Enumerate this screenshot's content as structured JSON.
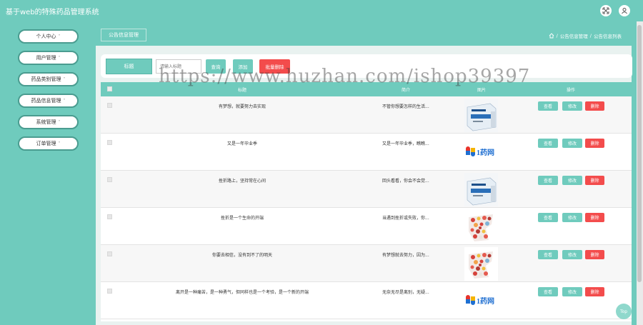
{
  "app": {
    "title": "基于web的特殊药品管理系统"
  },
  "topbar": {
    "icons": [
      "expand-icon",
      "user-icon"
    ]
  },
  "sidebar": {
    "items": [
      {
        "label": "个人中心"
      },
      {
        "label": "用户管理"
      },
      {
        "label": "药品类别管理"
      },
      {
        "label": "药品信息管理"
      },
      {
        "label": "系统管理"
      },
      {
        "label": "订单管理"
      }
    ],
    "chevron": "˅"
  },
  "content_header": {
    "section_button": "公告信息管理",
    "breadcrumb": {
      "sep": "/",
      "level1": "公告信息管理",
      "level2": "公告信息列表"
    }
  },
  "search": {
    "label": "标题",
    "placeholder": "请输入标题",
    "query_button": "查询",
    "add_button": "添加",
    "batch_delete_button": "批量删除"
  },
  "table": {
    "headers": {
      "title": "标题",
      "intro": "简介",
      "image": "图片",
      "actions": "操作"
    },
    "action_labels": {
      "view": "查看",
      "edit": "修改",
      "delete": "删除"
    },
    "rows": [
      {
        "title": "有梦想，就要努力去实现",
        "intro": "不管你想要怎样的生活...",
        "image_kind": "medicine-box",
        "image_brand": ""
      },
      {
        "title": "又是一年毕业季",
        "intro": "又是一年毕业季，瞧瞧...",
        "image_kind": "logo",
        "image_brand": "1药网"
      },
      {
        "title": "挫折路上，坚持常在心间",
        "intro": "回头看看，你会不会觉...",
        "image_kind": "medicine-box",
        "image_brand": ""
      },
      {
        "title": "挫折是一个生命的开端",
        "intro": "当遇到挫折或失败，你...",
        "image_kind": "pills",
        "image_brand": ""
      },
      {
        "title": "你要去相信，没有到不了的明天",
        "intro": "有梦想就去努力，因为...",
        "image_kind": "pills",
        "image_brand": ""
      },
      {
        "title": "离开是一种痛苦，是一种勇气，但同样也是一个考验，是一个新的开端",
        "intro": "无奈无尽是离别，无疑...",
        "image_kind": "logo",
        "image_brand": "1药网"
      }
    ]
  },
  "watermark": "https://www.huzhan.com/ishop39397",
  "fab": {
    "label": "Top"
  },
  "colors": {
    "accent": "#6fcbbd",
    "danger": "#f34c4c"
  }
}
